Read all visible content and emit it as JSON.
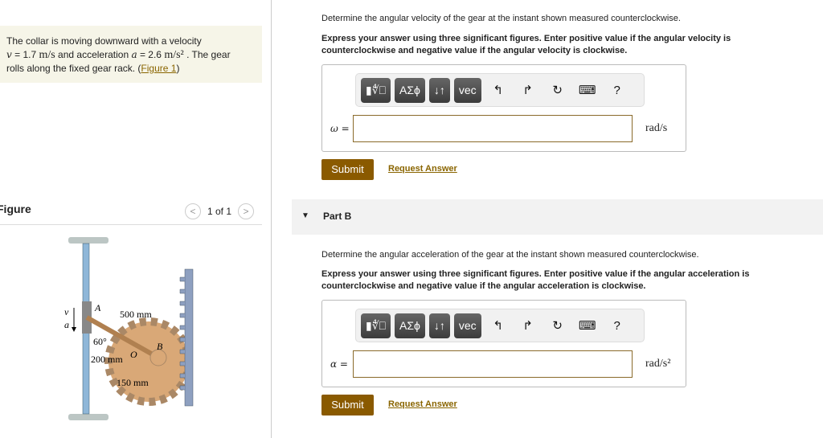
{
  "problem": {
    "text1": "The collar is moving downward with a velocity",
    "v_sym": "v",
    "eq": " = 1.7 ",
    "v_unit": "m/s",
    "text2": " and acceleration ",
    "a_sym": "a",
    "a_val": " = 2.6 ",
    "a_unit": "m/s²",
    "text3": " . The gear",
    "text4": "rolls along the fixed gear rack. (",
    "link": "Figure 1",
    "text5": ")"
  },
  "figure": {
    "title": "Figure",
    "pager": "1 of 1",
    "labels": {
      "v": "v",
      "a": "a",
      "A": "A",
      "B": "B",
      "O": "O",
      "d500": "500 mm",
      "d200": "200 mm",
      "d150": "150 mm",
      "angle": "60°"
    }
  },
  "partA": {
    "question": "Determine the angular velocity of the gear at the instant shown measured counterclockwise.",
    "instructions": "Express your answer using three significant figures. Enter positive value if the angular velocity is counterclockwise and negative value if the angular velocity is clockwise.",
    "var": "ω =",
    "unit": "rad/s",
    "value": "",
    "submit": "Submit",
    "request": "Request Answer"
  },
  "partB": {
    "title": "Part B",
    "question": "Determine the angular acceleration of the gear at the instant shown measured counterclockwise.",
    "instructions": "Express your answer using three significant figures. Enter positive value if the angular acceleration is counterclockwise and negative value if the angular acceleration is clockwise.",
    "var": "α =",
    "unit": "rad/s²",
    "value": "",
    "submit": "Submit",
    "request": "Request Answer"
  },
  "toolbar": {
    "templates": "▮∜⎕",
    "greek": "ΑΣϕ",
    "arrows": "↓↑",
    "vec": "vec",
    "undo": "↰",
    "redo": "↱",
    "reset": "↻",
    "keyboard": "⌨",
    "help": "?"
  }
}
